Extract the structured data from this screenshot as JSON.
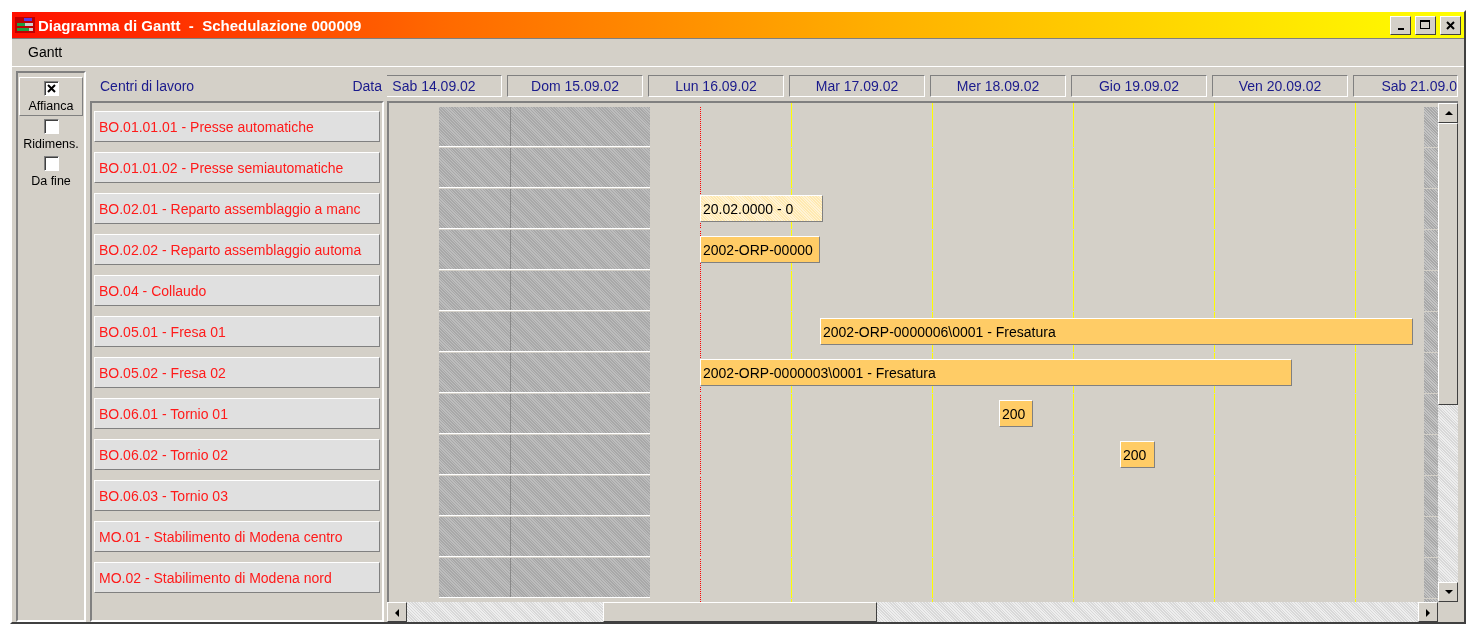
{
  "window": {
    "title": "Diagramma di Gantt  -  Schedulazione 000009"
  },
  "menu": [
    "Gantt"
  ],
  "options": [
    {
      "label": "Affianca",
      "checked": true,
      "selected": true
    },
    {
      "label": "Ridimens.",
      "checked": false,
      "selected": false
    },
    {
      "label": "Da fine",
      "checked": false,
      "selected": false
    }
  ],
  "resources_header": {
    "title": "Centri di lavoro",
    "date_label": "Data"
  },
  "days": [
    "Sab 14.09.02",
    "Dom 15.09.02",
    "Lun 16.09.02",
    "Mar 17.09.02",
    "Mer 18.09.02",
    "Gio 19.09.02",
    "Ven 20.09.02",
    "Sab 21.09.0"
  ],
  "rows": [
    {
      "name": "BO.01.01.01 - Presse automatiche"
    },
    {
      "name": "BO.01.01.02 - Presse semiautomatiche"
    },
    {
      "name": "BO.02.01 - Reparto assemblaggio a manc",
      "task": {
        "label": "20.02.0000 - 0",
        "kind": "planned"
      }
    },
    {
      "name": "BO.02.02 - Reparto assemblaggio automa",
      "task": {
        "label": "2002-ORP-00000",
        "kind": "order"
      }
    },
    {
      "name": "BO.04 - Collaudo"
    },
    {
      "name": "BO.05.01 - Fresa 01",
      "task": {
        "label": "2002-ORP-0000006\\0001 - Fresatura",
        "kind": "order"
      }
    },
    {
      "name": "BO.05.02 - Fresa 02",
      "task": {
        "label": "2002-ORP-0000003\\0001 - Fresatura",
        "kind": "order"
      }
    },
    {
      "name": "BO.06.01 - Tornio 01",
      "task": {
        "label": "200",
        "kind": "order"
      }
    },
    {
      "name": "BO.06.02 - Tornio 02",
      "task": {
        "label": "200",
        "kind": "order"
      }
    },
    {
      "name": "BO.06.03 - Tornio 03"
    },
    {
      "name": "MO.01 - Stabilimento di Modena centro"
    },
    {
      "name": "MO.02 - Stabilimento di Modena nord"
    }
  ]
}
